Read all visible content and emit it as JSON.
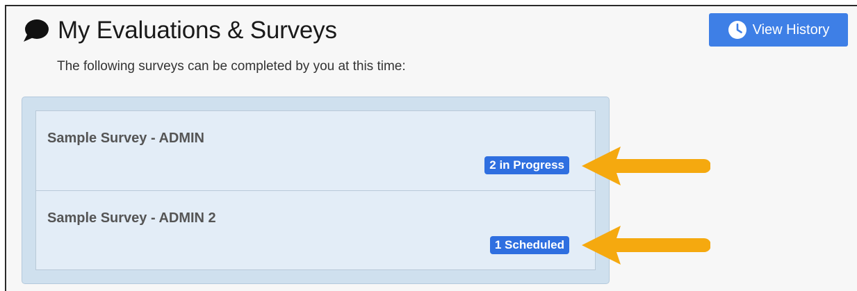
{
  "header": {
    "title": "My Evaluations & Surveys",
    "subtitle": "The following surveys can be completed by you at this time:",
    "title_icon": "speech-bubble-icon"
  },
  "toolbar": {
    "history_label": "View History",
    "history_icon": "clock-icon"
  },
  "surveys": [
    {
      "name": "Sample Survey - ADMIN",
      "status": "2 in Progress"
    },
    {
      "name": "Sample Survey - ADMIN 2",
      "status": "1 Scheduled"
    }
  ],
  "annotations": {
    "arrow_icon": "arrow-left-icon"
  },
  "colors": {
    "accent": "#3e7fe6",
    "badge": "#2f6fe0",
    "panel": "#cfe0ee",
    "list": "#e3edf7",
    "arrow": "#f5a90f"
  }
}
